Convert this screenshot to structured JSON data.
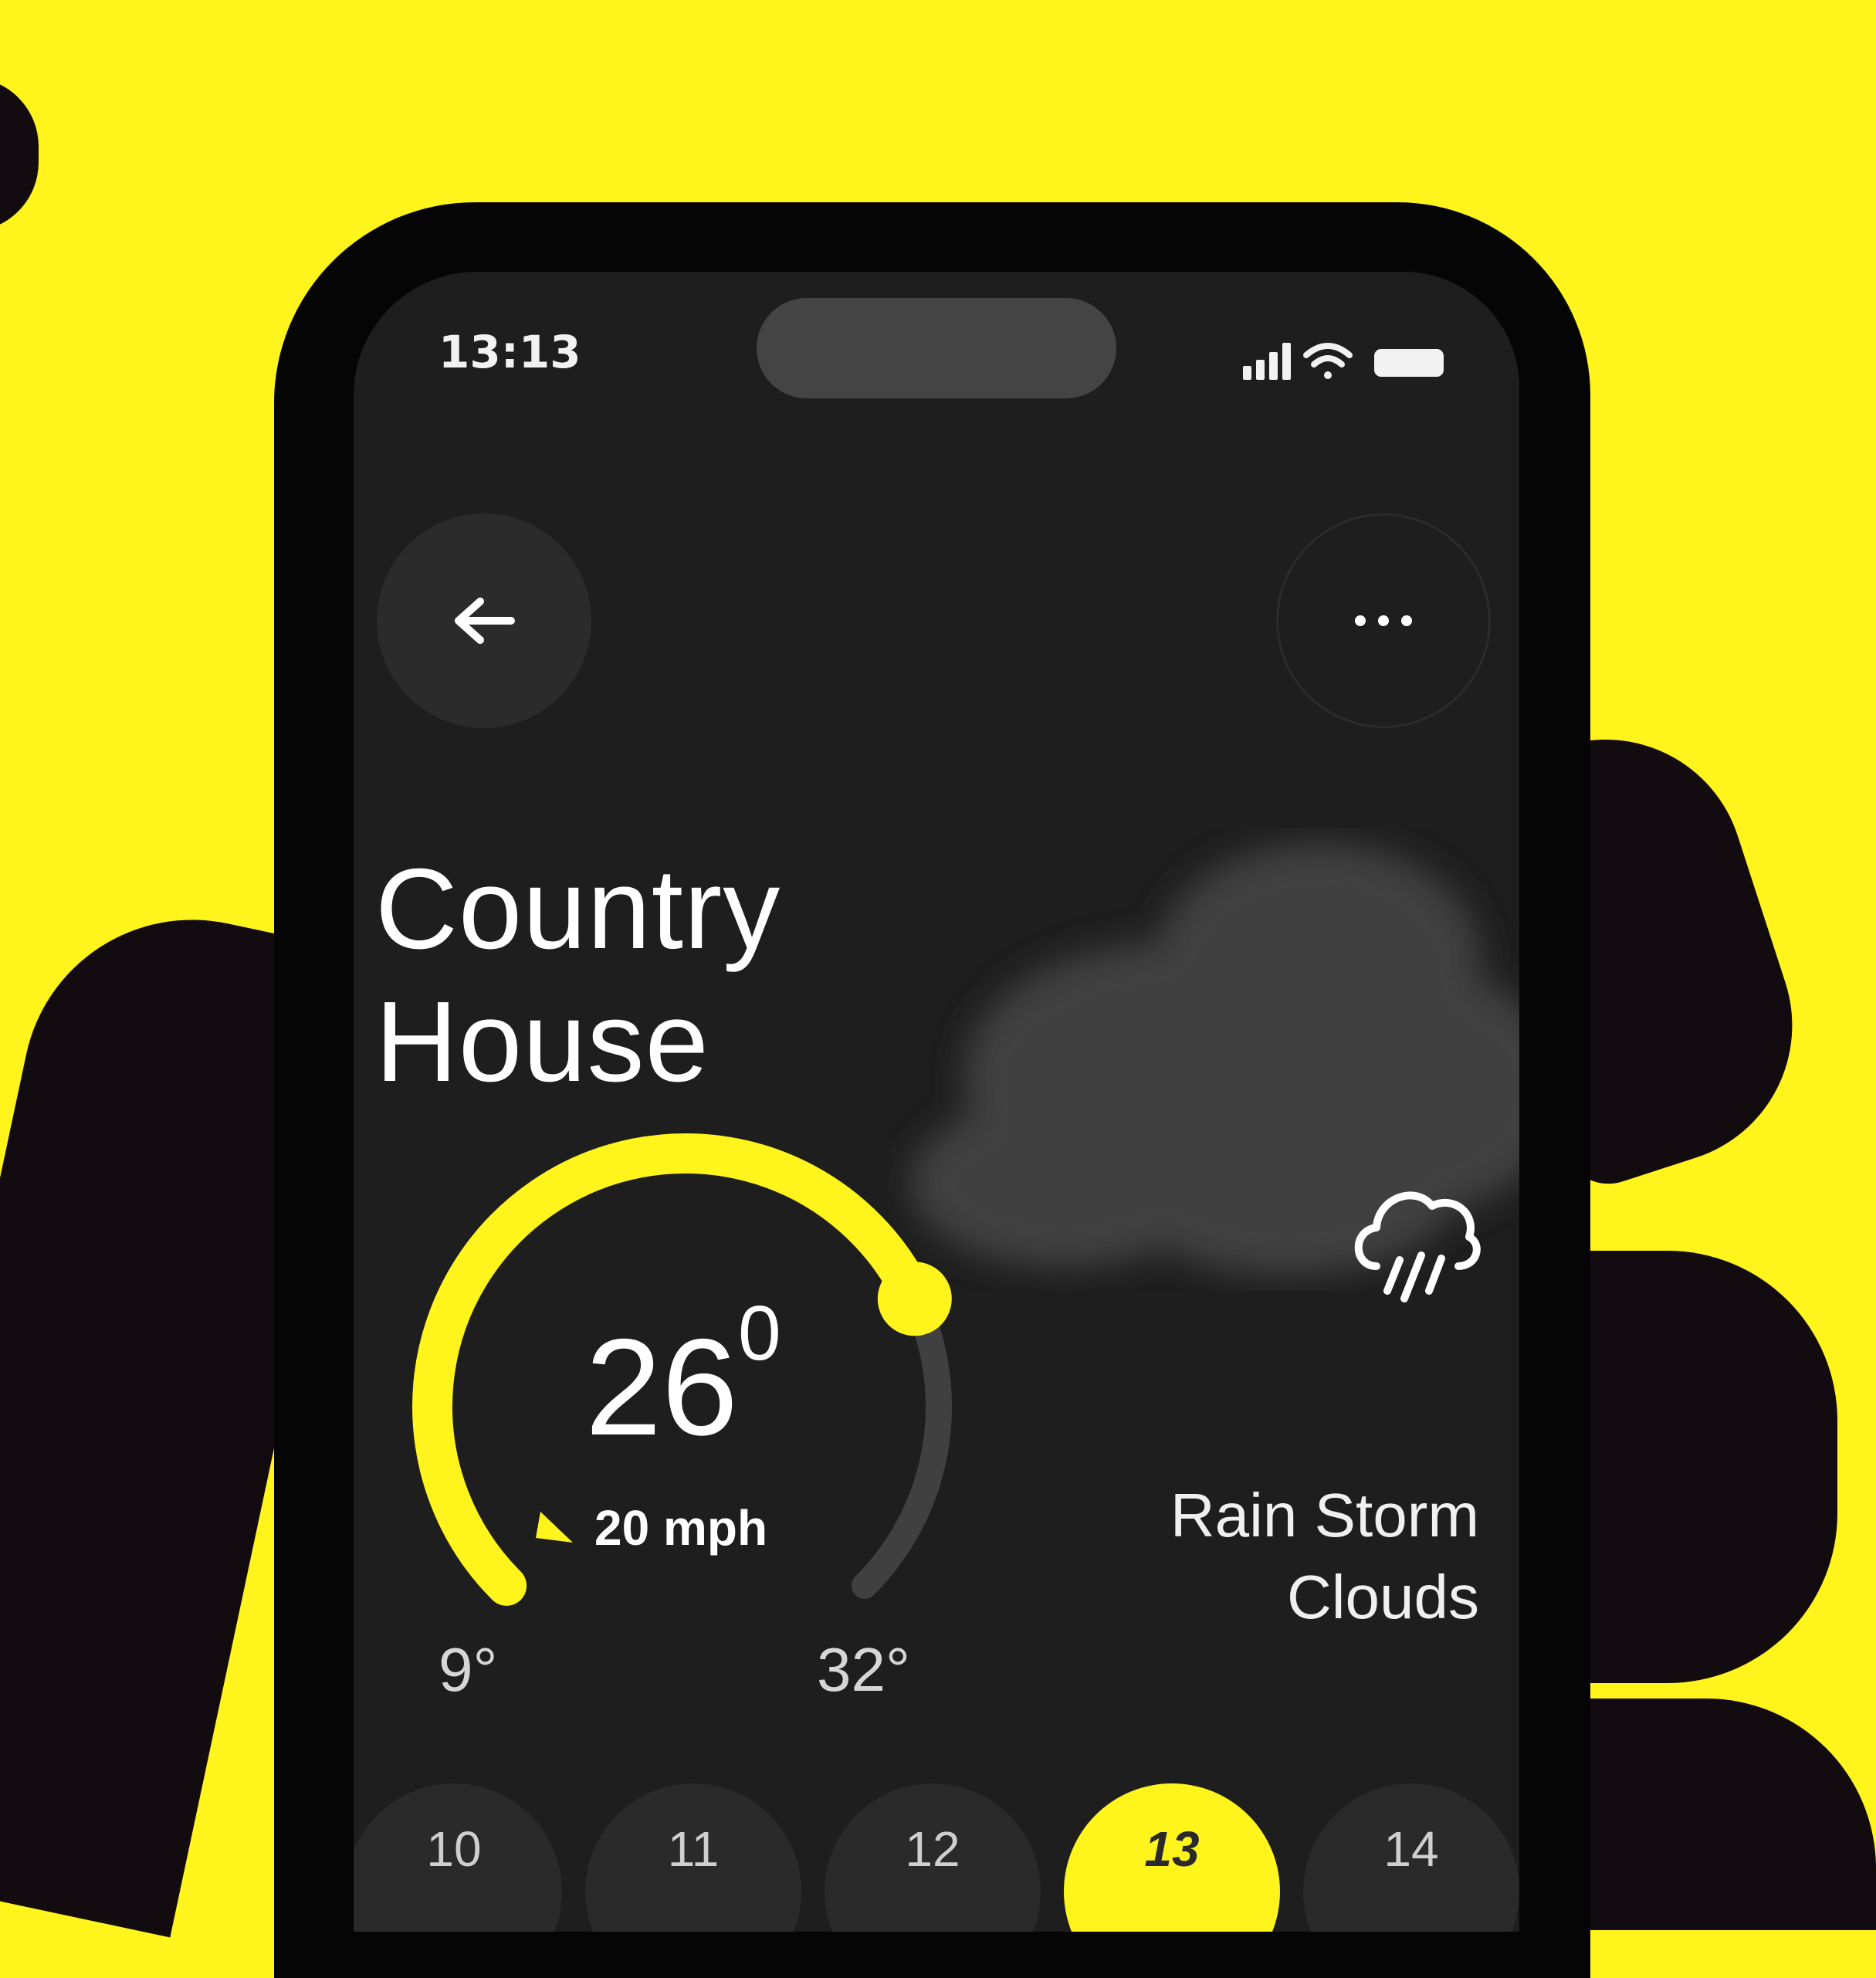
{
  "colors": {
    "background": "#FFF41C",
    "accent": "#FFF41C",
    "screen": "#1E1E1E"
  },
  "status_bar": {
    "time": "13:13"
  },
  "header": {
    "back_icon": "arrow-left-icon",
    "more_icon": "more-horizontal-icon"
  },
  "location": {
    "line1": "Country",
    "line2": "House"
  },
  "weather": {
    "temperature": "26",
    "degree_mark": "0",
    "wind": "20 mph",
    "low": "9°",
    "high": "32°",
    "gauge_fraction": 0.74,
    "condition_line1": "Rain Storm",
    "condition_line2": "Clouds",
    "condition_icon": "cloud-rain-icon"
  },
  "days": [
    {
      "label": "10",
      "selected": false
    },
    {
      "label": "11",
      "selected": false
    },
    {
      "label": "12",
      "selected": false
    },
    {
      "label": "13",
      "selected": true
    },
    {
      "label": "14",
      "selected": false
    }
  ]
}
